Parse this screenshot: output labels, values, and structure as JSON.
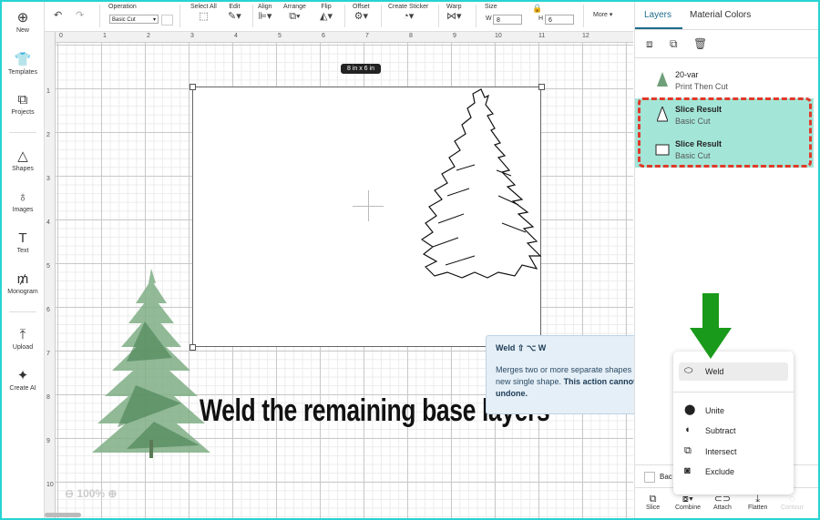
{
  "left_toolbar": {
    "items": [
      {
        "icon": "plus-circle-icon",
        "label": "New"
      },
      {
        "icon": "shirt-icon",
        "label": "Templates"
      },
      {
        "icon": "projects-icon",
        "label": "Projects"
      },
      {
        "icon": "shapes-icon",
        "label": "Shapes"
      },
      {
        "icon": "images-icon",
        "label": "Images"
      },
      {
        "icon": "text-icon",
        "label": "Text"
      },
      {
        "icon": "monogram-icon",
        "label": "Monogram"
      },
      {
        "icon": "upload-icon",
        "label": "Upload"
      },
      {
        "icon": "sparkle-icon",
        "label": "Create AI"
      }
    ]
  },
  "top_toolbar": {
    "undo_icon": "undo-icon",
    "redo_icon": "redo-icon",
    "operation_label": "Operation",
    "operation_value": "Basic Cut",
    "select_all": "Select All",
    "edit": "Edit",
    "align": "Align",
    "arrange": "Arrange",
    "flip": "Flip",
    "offset": "Offset",
    "create_sticker": "Create Sticker",
    "warp": "Warp",
    "size": "Size",
    "w_label": "W",
    "w_value": "8",
    "h_label": "H",
    "h_value": "6",
    "more": "More ▾"
  },
  "canvas": {
    "h_ruler": [
      "0",
      "1",
      "2",
      "3",
      "4",
      "5",
      "6",
      "7",
      "8",
      "9",
      "10",
      "11",
      "12"
    ],
    "v_ruler": [
      "1",
      "2",
      "3",
      "4",
      "5",
      "6",
      "7",
      "8",
      "9",
      "10"
    ],
    "size_tag": "8  in x 6  in",
    "zoom": "100%",
    "caption": "Weld the remaining base layers"
  },
  "tooltip": {
    "title": "Weld ⇧ ⌥ W",
    "body_normal": "Merges two or more separate shapes into a new single shape. ",
    "body_bold": "This action cannot be undone."
  },
  "right_panel": {
    "tabs": [
      "Layers",
      "Material Colors"
    ],
    "active_tab": "Layers",
    "toolbar_icons": [
      "group-icon",
      "duplicate-icon",
      "delete-icon"
    ],
    "layers": [
      {
        "name": "20-var",
        "sub": "Print Then Cut",
        "highlighted": false,
        "bold": false
      },
      {
        "name": "Slice Result",
        "sub": "Basic Cut",
        "highlighted": true,
        "bold": true
      },
      {
        "name": "Slice Result",
        "sub": "Basic Cut",
        "highlighted": true,
        "bold": true
      }
    ],
    "highlight_color": "#a3e6d8",
    "dash_color": "#e03a2a",
    "blank_label": "Bac",
    "bottom_actions": [
      "Slice",
      "Combine",
      "Attach",
      "Flatten",
      "Contour"
    ]
  },
  "combine_menu": {
    "items": [
      {
        "icon": "weld-icon",
        "label": "Weld"
      },
      {
        "icon": "unite-icon",
        "label": "Unite"
      },
      {
        "icon": "subtract-icon",
        "label": "Subtract"
      },
      {
        "icon": "intersect-icon",
        "label": "Intersect"
      },
      {
        "icon": "exclude-icon",
        "label": "Exclude"
      }
    ]
  },
  "arrow_color": "#1a9a1a",
  "frame_color": "#29d3d3"
}
